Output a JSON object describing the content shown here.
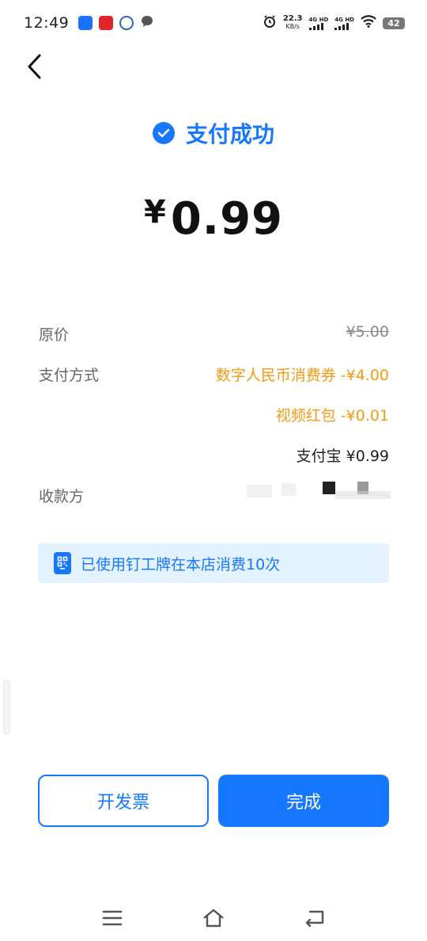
{
  "status_bar": {
    "time": "12:49",
    "net_speed_value": "22.3",
    "net_speed_unit": "KB/s",
    "sim1_label": "4G HD",
    "sim2_label": "4G HD",
    "battery": "42",
    "icons": [
      "app-blue-icon",
      "app-red-icon",
      "app-blue-circle-icon",
      "message-bubble-icon",
      "alarm-icon",
      "signal-icon",
      "wifi-icon",
      "battery-icon"
    ]
  },
  "header": {
    "title": "支付成功"
  },
  "payment": {
    "currency_symbol": "¥",
    "amount": "0.99"
  },
  "details": {
    "original_price_label": "原价",
    "original_price_value": "¥5.00",
    "method_label": "支付方式",
    "method_lines": [
      "数字人民币消费券 -¥4.00",
      "视频红包 -¥0.01",
      "支付宝 ¥0.99"
    ],
    "payee_label": "收款方"
  },
  "info_bar": {
    "text": "已使用钉工牌在本店消费10次"
  },
  "buttons": {
    "invoice": "开发票",
    "done": "完成"
  },
  "colors": {
    "accent": "#1677ff",
    "discount": "#f59a12",
    "info_bg": "#e3f2fd"
  }
}
